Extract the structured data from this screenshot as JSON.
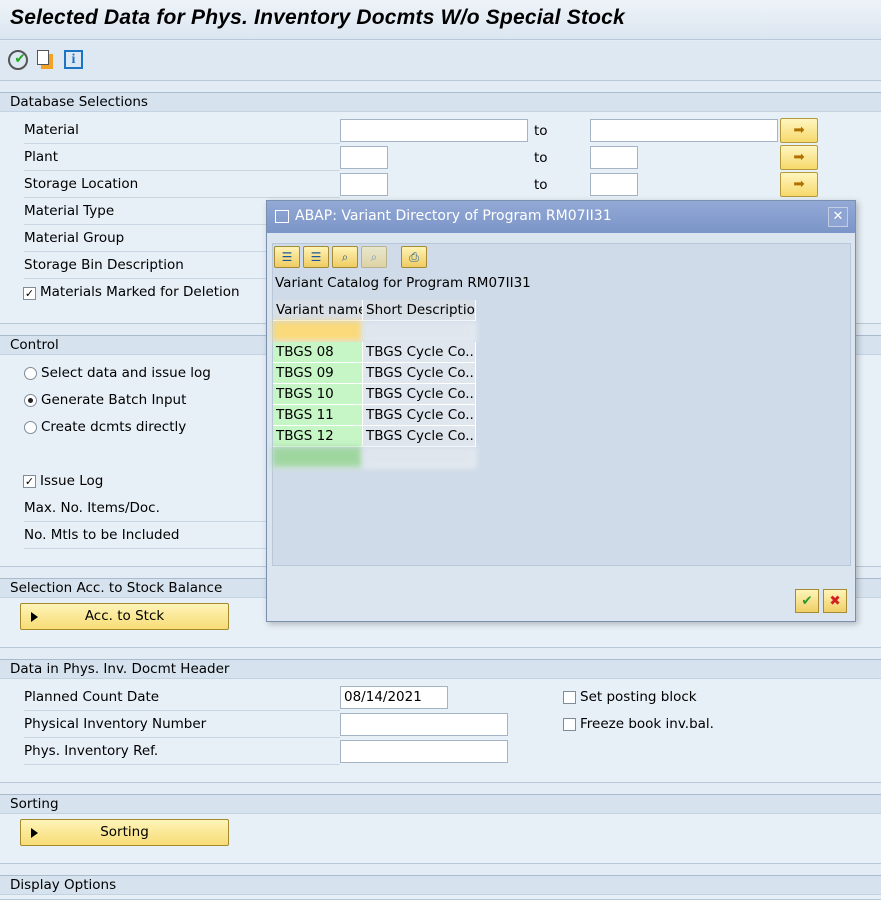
{
  "window": {
    "title": "Selected Data for Phys. Inventory Docmts W/o Special Stock"
  },
  "toolbar": {
    "icons": [
      "execute-icon",
      "variants-icon",
      "info-icon"
    ]
  },
  "db": {
    "header": "Database Selections",
    "to": "to",
    "rows": [
      {
        "label": "Material"
      },
      {
        "label": "Plant"
      },
      {
        "label": "Storage Location"
      },
      {
        "label": "Material Type"
      },
      {
        "label": "Material Group"
      },
      {
        "label": "Storage Bin Description"
      }
    ],
    "deletion_label": "Materials Marked for Deletion",
    "deletion_checked": true
  },
  "control": {
    "header": "Control",
    "radios": [
      {
        "label": "Select data and issue log",
        "selected": false
      },
      {
        "label": "Generate Batch Input",
        "selected": true
      },
      {
        "label": "Create dcmts directly",
        "selected": false
      }
    ],
    "issue_log": "Issue Log",
    "issue_log_checked": true,
    "max_items": "Max. No. Items/Doc.",
    "no_mtls": "No. Mtls to be Included"
  },
  "stock": {
    "header": "Selection Acc. to Stock Balance",
    "button": "Acc. to Stck"
  },
  "hdr": {
    "header": "Data in Phys. Inv. Docmt Header",
    "planned_count_date_label": "Planned Count Date",
    "planned_count_date": "08/14/2021",
    "pi_number_label": "Physical Inventory Number",
    "pi_ref_label": "Phys. Inventory Ref.",
    "posting_block": "Set posting block",
    "freeze": "Freeze book inv.bal."
  },
  "sorting": {
    "header": "Sorting",
    "button": "Sorting"
  },
  "display": {
    "header": "Display Options"
  },
  "dialog": {
    "title": "ABAP: Variant Directory of Program RM07II31",
    "catalog": "Variant Catalog for Program RM07II31",
    "columns": [
      "Variant name",
      "Short Description"
    ],
    "rows": [
      [
        "TBGS 08",
        "TBGS Cycle Co..."
      ],
      [
        "TBGS 09",
        "TBGS Cycle Co..."
      ],
      [
        "TBGS 10",
        "TBGS Cycle Co..."
      ],
      [
        "TBGS 11",
        "TBGS Cycle Co..."
      ],
      [
        "TBGS 12",
        "TBGS Cycle Co..."
      ]
    ],
    "colors": {
      "selected_row": "#f9d97a",
      "variant_cell": "#c6f5c6",
      "title_bar": "#7b95c8"
    }
  }
}
